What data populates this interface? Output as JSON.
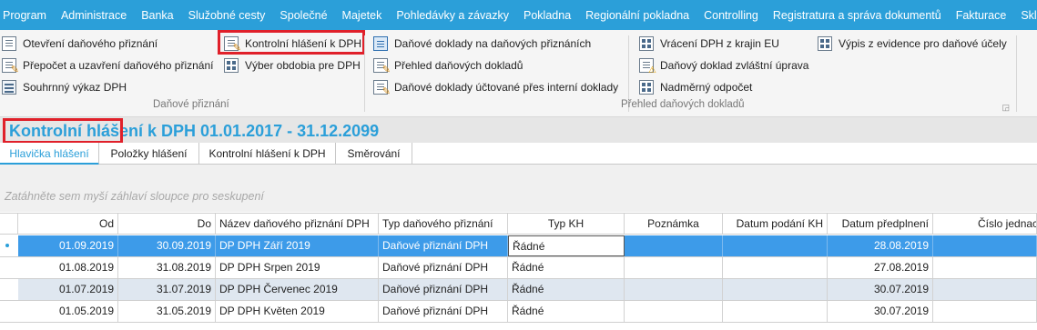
{
  "menu": [
    "Program",
    "Administrace",
    "Banka",
    "Služobné cesty",
    "Společné",
    "Majetek",
    "Pohledávky a závazky",
    "Pokladna",
    "Regionální pokladna",
    "Controlling",
    "Registratura a správa dokumentů",
    "Fakturace",
    "Sklady"
  ],
  "ribbon": {
    "g1": {
      "items": [
        "Otevření daňového přiznání",
        "Přepočet a uzavření daňového přiznání",
        "Souhrnný výkaz DPH",
        "Kontrolní hlášení k DPH",
        "Výber obdobia pre DPH"
      ],
      "label": "Daňové přiznání"
    },
    "g2": {
      "items": [
        "Daňové doklady na daňových přiznáních",
        "Přehled daňových dokladů",
        "Daňové doklady účtované přes interní doklady",
        "Vrácení DPH z krajin EU",
        "Daňový doklad zvláštní úprava",
        "Nadměrný odpočet",
        "Výpis z evidence pro daňové účely"
      ],
      "label": "Přehled daňových dokladů"
    }
  },
  "page": {
    "title": "Kontrolní hlášení k DPH 01.01.2017 - 31.12.2099",
    "tabs": [
      "Hlavička hlášení",
      "Položky hlášení",
      "Kontrolní hlášení k DPH",
      "Směrování"
    ],
    "group_hint": "Zatáhněte sem myší záhlaví sloupce pro seskupení"
  },
  "table": {
    "columns": [
      "Od",
      "Do",
      "Název daňového přiznání DPH",
      "Typ daňového přiznání",
      "Typ KH",
      "Poznámka",
      "Datum podání KH",
      "Datum předplnení",
      "Číslo jednac"
    ],
    "rows": [
      [
        "01.09.2019",
        "30.09.2019",
        "DP DPH Září 2019",
        "Daňové přiznání DPH",
        "Řádné",
        "",
        "",
        "28.08.2019",
        ""
      ],
      [
        "01.08.2019",
        "31.08.2019",
        "DP DPH Srpen 2019",
        "Daňové přiznání DPH",
        "Řádné",
        "",
        "",
        "27.08.2019",
        ""
      ],
      [
        "01.07.2019",
        "31.07.2019",
        "DP DPH Červenec 2019",
        "Daňové přiznání DPH",
        "Řádné",
        "",
        "",
        "30.07.2019",
        ""
      ],
      [
        "01.05.2019",
        "31.05.2019",
        "DP DPH Květen 2019",
        "Daňové přiznání DPH",
        "Řádné",
        "",
        "",
        "30.07.2019",
        ""
      ]
    ]
  },
  "colors": {
    "accent": "#2b9fd9",
    "selected_row": "#3d9be9",
    "highlight": "#e0202a"
  }
}
